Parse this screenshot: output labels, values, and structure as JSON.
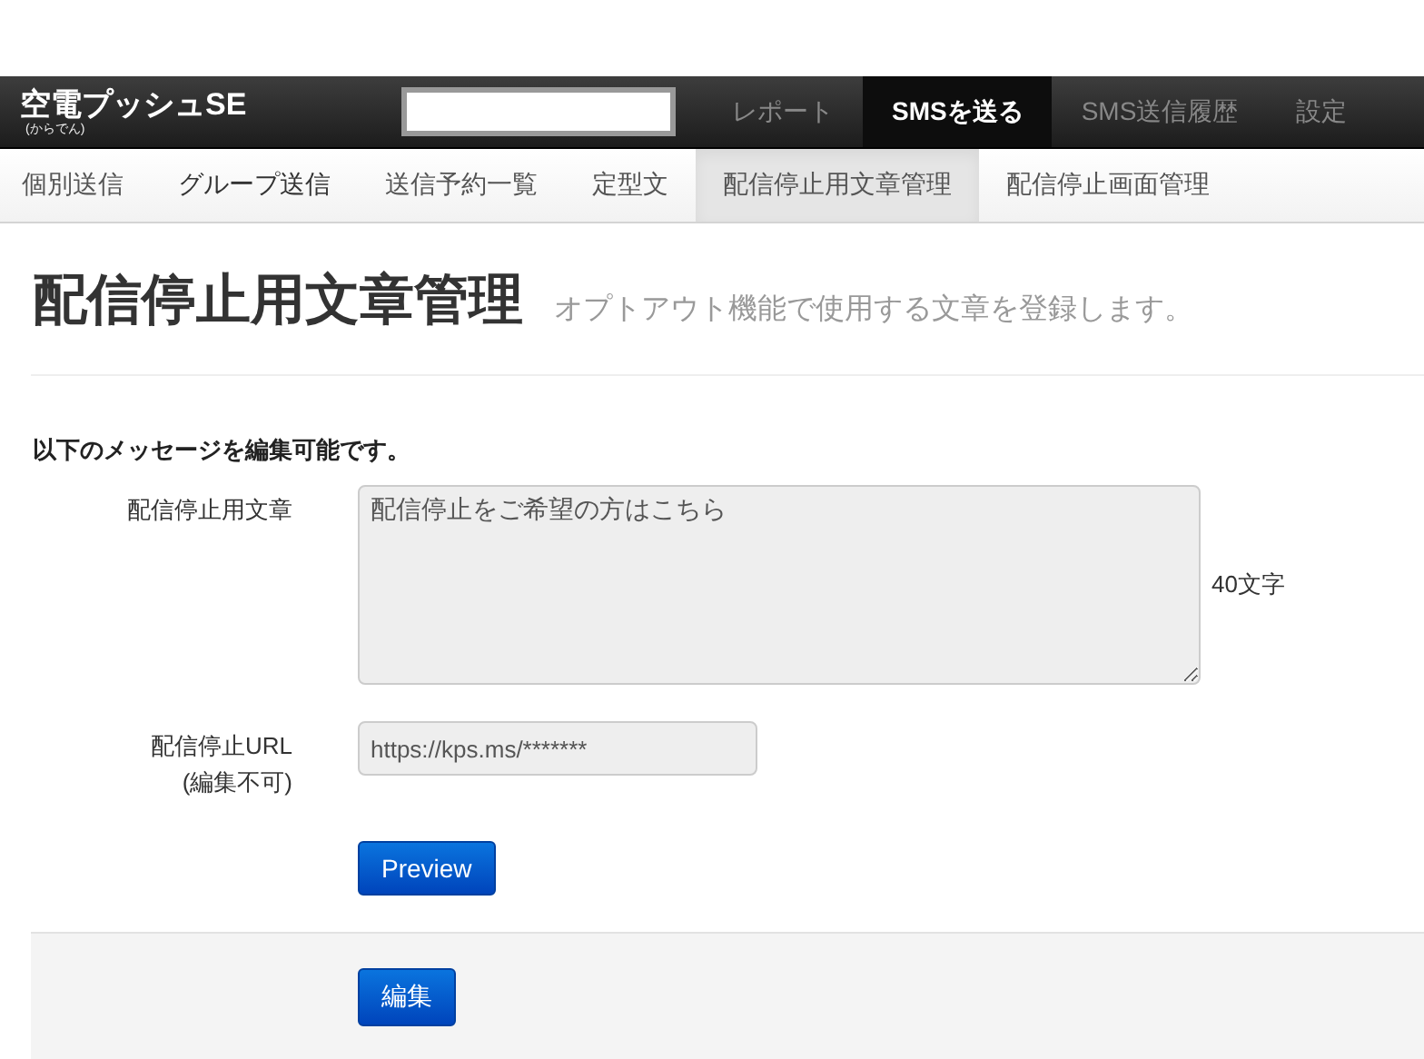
{
  "navbar": {
    "logo": "空電プッシュSE",
    "logo_reading": "(からでん)",
    "items": [
      {
        "label": "レポート",
        "selected": false
      },
      {
        "label": "SMSを送る",
        "selected": true
      },
      {
        "label": "SMS送信履歴",
        "selected": false
      },
      {
        "label": "設定",
        "selected": false
      }
    ]
  },
  "subnav": {
    "items": [
      {
        "label": "個別送信",
        "selected": false
      },
      {
        "label": "グループ送信",
        "selected": false
      },
      {
        "label": "送信予約一覧",
        "selected": false
      },
      {
        "label": "定型文",
        "selected": false
      },
      {
        "label": "配信停止用文章管理",
        "selected": true
      },
      {
        "label": "配信停止画面管理",
        "selected": false
      }
    ]
  },
  "page": {
    "title": "配信停止用文章管理",
    "subtitle": "オプトアウト機能で使用する文章を登録します。"
  },
  "form": {
    "intro": "以下のメッセージを編集可能です。",
    "message": {
      "label": "配信停止用文章",
      "value": "配信停止をご希望の方はこちら",
      "count": "40文字"
    },
    "url": {
      "label": "配信停止URL",
      "note": "(編集不可)",
      "value": "https://kps.ms/*******",
      "disabled": true
    },
    "preview_button": "Preview",
    "edit_button": "編集"
  }
}
